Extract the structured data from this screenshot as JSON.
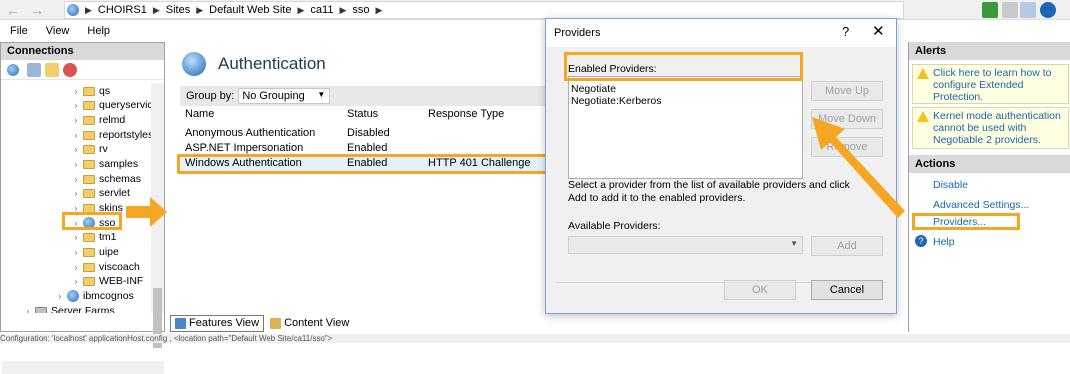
{
  "breadcrumb": [
    "CHOIRS1",
    "Sites",
    "Default Web Site",
    "ca11",
    "sso"
  ],
  "menu": [
    "File",
    "View",
    "Help"
  ],
  "connections": {
    "title": "Connections",
    "tree": [
      "qs",
      "queryservic",
      "relmd",
      "reportstyles",
      "rv",
      "samples",
      "schemas",
      "servlet",
      "skins",
      "sso",
      "tm1",
      "uipe",
      "viscoach",
      "WEB-INF",
      "ibmcognos",
      "Server Farms"
    ]
  },
  "auth": {
    "title": "Authentication",
    "group_by_label": "Group by:",
    "group_by_value": "No Grouping",
    "columns": [
      "Name",
      "Status",
      "Response Type"
    ],
    "rows": [
      {
        "name": "Anonymous Authentication",
        "status": "Disabled",
        "response": ""
      },
      {
        "name": "ASP.NET Impersonation",
        "status": "Enabled",
        "response": ""
      },
      {
        "name": "Windows Authentication",
        "status": "Enabled",
        "response": "HTTP 401 Challenge"
      }
    ],
    "view_tabs": [
      "Features View",
      "Content View"
    ]
  },
  "dialog": {
    "title": "Providers",
    "help": "?",
    "close": "✕",
    "enabled_label": "Enabled Providers:",
    "enabled": [
      "Negotiate",
      "Negotiate:Kerberos"
    ],
    "move_up": "Move Up",
    "move_down": "Move Down",
    "remove": "Remove",
    "instruction": "Select a provider from the list of available providers and click Add to add it to the enabled providers.",
    "available_label": "Available Providers:",
    "add": "Add",
    "ok": "OK",
    "cancel": "Cancel"
  },
  "alerts": {
    "title": "Alerts",
    "items": [
      "Click here to learn how to configure Extended Protection.",
      "Kernel mode authentication cannot be used with Negotiable 2 providers."
    ]
  },
  "actions": {
    "title": "Actions",
    "items": [
      "Disable",
      "Advanced Settings...",
      "Providers...",
      "Help"
    ]
  },
  "status": "Configuration: 'localhost' applicationHost.config , <location path=\"Default Web Site/ca11/sso\">",
  "colors": {
    "highlight": "#f5a623",
    "link": "#1a66b0"
  }
}
